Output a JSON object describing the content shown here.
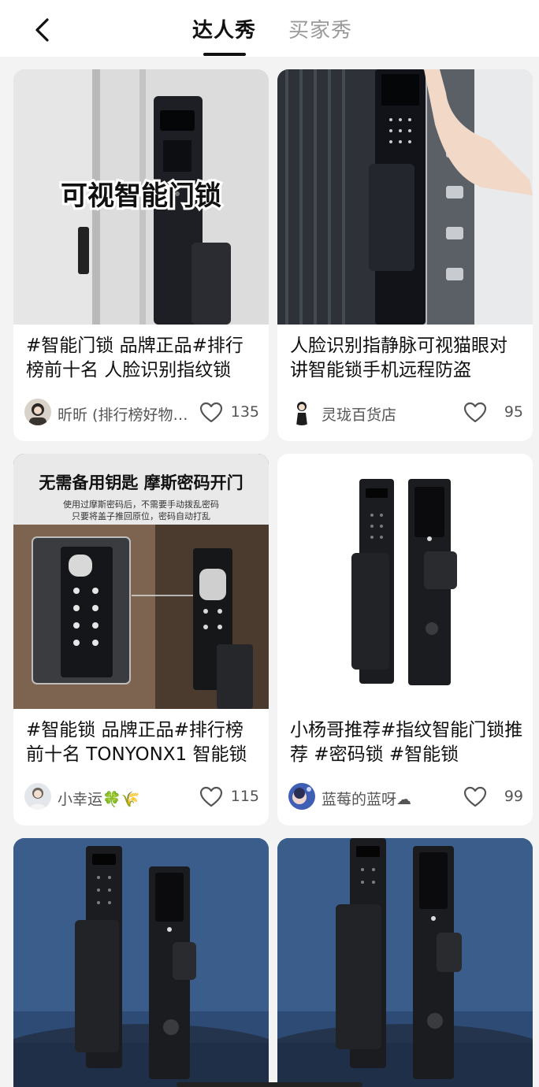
{
  "header": {
    "tabs": [
      {
        "label": "达人秀",
        "active": true
      },
      {
        "label": "买家秀",
        "active": false
      }
    ]
  },
  "cards": [
    {
      "image_text": "可视智能门锁",
      "title": "#智能门锁 品牌正品#排行榜前十名 人脸识别指纹锁",
      "author": "昕昕 (排行榜好物推荐)",
      "likes": "135"
    },
    {
      "title": " 人脸识别指静脉可视猫眼对讲智能锁手机远程防盗",
      "author": "灵珑百货店",
      "likes": "95"
    },
    {
      "image_text": "无需备用钥匙 摩斯密码开门",
      "image_subtext_1": "使用过摩斯密码后，不需要手动拨乱密码",
      "image_subtext_2": "只要将盖子推回原位，密码自动打乱",
      "title": "#智能锁 品牌正品#排行榜前十名 TONYONX1 智能锁",
      "author": "小幸运🍀🌾",
      "likes": "115"
    },
    {
      "title": "小杨哥推荐#指纹智能门锁推荐 #密码锁 #智能锁",
      "author": "蓝莓的蓝呀☁",
      "likes": "99"
    }
  ],
  "colors": {
    "background": "#f3f3f3",
    "card": "#ffffff",
    "text": "#111111",
    "muted": "#555555",
    "inactive_tab": "#9a9a9a"
  }
}
